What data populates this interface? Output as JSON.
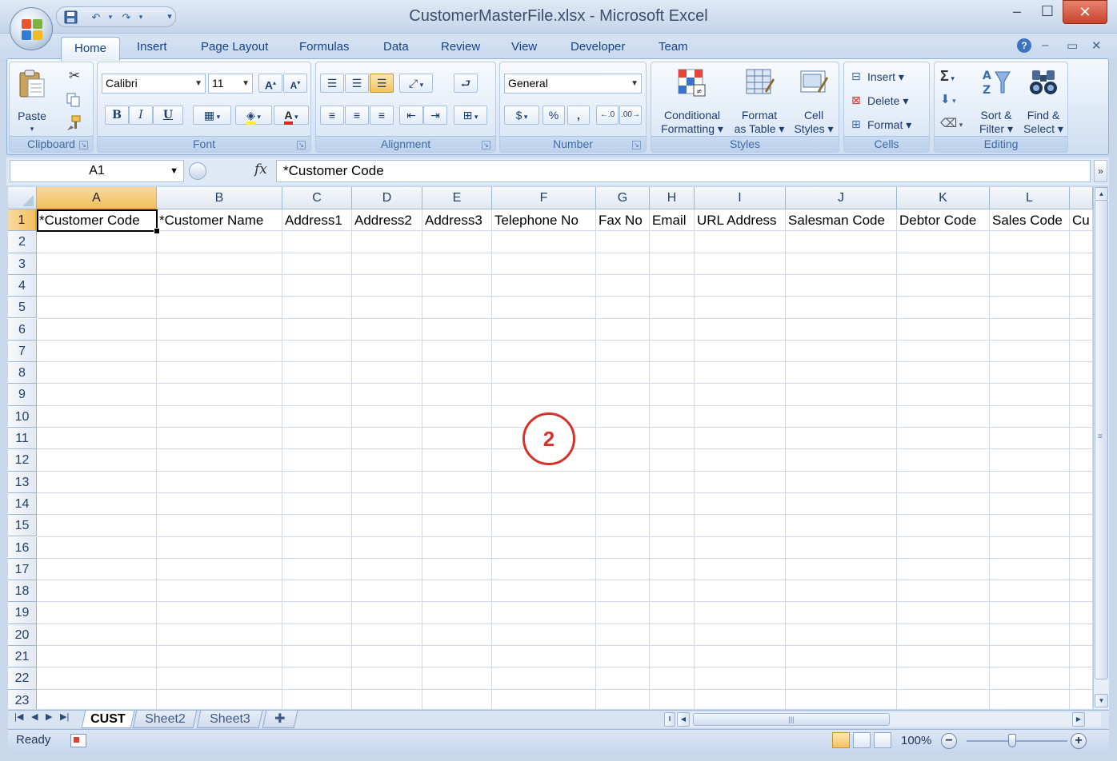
{
  "window": {
    "title": "CustomerMasterFile.xlsx - Microsoft Excel",
    "minimize": "–",
    "maximize": "☐",
    "close": "✕"
  },
  "ribbon_tabs": [
    "Home",
    "Insert",
    "Page Layout",
    "Formulas",
    "Data",
    "Review",
    "View",
    "Developer",
    "Team"
  ],
  "active_tab": "Home",
  "ribbon": {
    "clipboard": {
      "label": "Clipboard",
      "paste": "Paste"
    },
    "font": {
      "label": "Font",
      "name": "Calibri",
      "size": "11",
      "bold": "B",
      "italic": "I",
      "underline": "U"
    },
    "alignment": {
      "label": "Alignment"
    },
    "number": {
      "label": "Number",
      "format": "General",
      "percent": "%",
      "comma": ","
    },
    "styles": {
      "label": "Styles",
      "conditional_1": "Conditional",
      "conditional_2": "Formatting ▾",
      "format_table_1": "Format",
      "format_table_2": "as Table ▾",
      "cell_styles_1": "Cell",
      "cell_styles_2": "Styles ▾"
    },
    "cells": {
      "label": "Cells",
      "insert": "Insert ▾",
      "delete": "Delete ▾",
      "format": "Format ▾"
    },
    "editing": {
      "label": "Editing",
      "sort_1": "Sort &",
      "sort_2": "Filter ▾",
      "find_1": "Find &",
      "find_2": "Select ▾"
    }
  },
  "formula_bar": {
    "name_box": "A1",
    "fx": "fx",
    "content": "*Customer Code"
  },
  "sheet": {
    "columns": [
      "A",
      "B",
      "C",
      "D",
      "E",
      "F",
      "G",
      "H",
      "I",
      "J",
      "K",
      "L"
    ],
    "selected_column": "A",
    "selected_row": 1,
    "rows": [
      "1",
      "2",
      "3",
      "4",
      "5",
      "6",
      "7",
      "8",
      "9",
      "10",
      "11",
      "12",
      "13",
      "14",
      "15",
      "16",
      "17",
      "18",
      "19",
      "20",
      "21",
      "22",
      "23"
    ],
    "header_values": [
      "*Customer Code",
      "*Customer Name",
      "Address1",
      "Address2",
      "Address3",
      "Telephone No",
      "Fax No",
      "Email",
      "URL Address",
      "Salesman Code",
      "Debtor Code",
      "Sales Code",
      "Cu"
    ]
  },
  "sheet_tabs": [
    "CUST",
    "Sheet2",
    "Sheet3"
  ],
  "active_sheet": "CUST",
  "status": {
    "ready": "Ready",
    "zoom": "100%",
    "zoom_minus": "−",
    "zoom_plus": "+"
  },
  "annotation": "2",
  "colors": {
    "selection_header": "#f1c15f",
    "ribbon_text": "#15428b",
    "annotation": "#d8312a",
    "close_button": "#c9432c"
  }
}
